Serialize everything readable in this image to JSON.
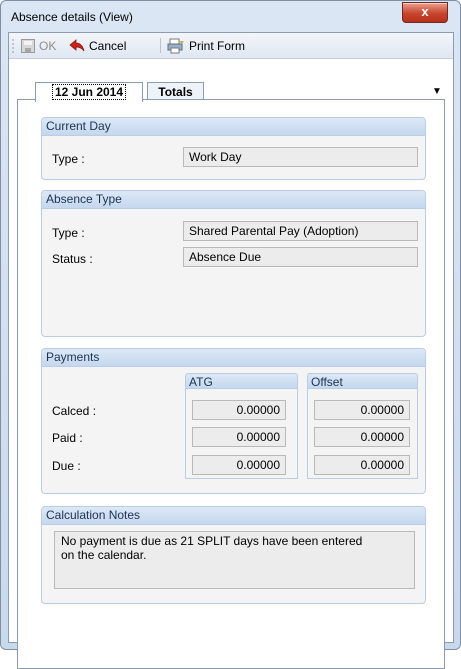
{
  "window": {
    "title": "Absence details (View)",
    "close_glyph": "x"
  },
  "toolbar": {
    "ok_label": "OK",
    "cancel_label": "Cancel",
    "print_label": "Print Form"
  },
  "tabs": [
    {
      "label": "12 Jun 2014",
      "active": true
    },
    {
      "label": "Totals",
      "active": false
    }
  ],
  "tab_dropdown_glyph": "▼",
  "current_day": {
    "header": "Current Day",
    "type_label": "Type :",
    "type_value": "Work Day"
  },
  "absence_type": {
    "header": "Absence Type",
    "type_label": "Type :",
    "type_value": "Shared Parental Pay (Adoption)",
    "status_label": "Status :",
    "status_value": "Absence Due"
  },
  "payments": {
    "header": "Payments",
    "columns": [
      "ATG",
      "Offset"
    ],
    "rows": [
      {
        "label": "Calced :",
        "atg": "0.00000",
        "offset": "0.00000"
      },
      {
        "label": "Paid :",
        "atg": "0.00000",
        "offset": "0.00000"
      },
      {
        "label": "Due :",
        "atg": "0.00000",
        "offset": "0.00000"
      }
    ]
  },
  "calculation_notes": {
    "header": "Calculation Notes",
    "text": "No payment is due as 21 SPLIT days have been entered\non the calendar."
  }
}
